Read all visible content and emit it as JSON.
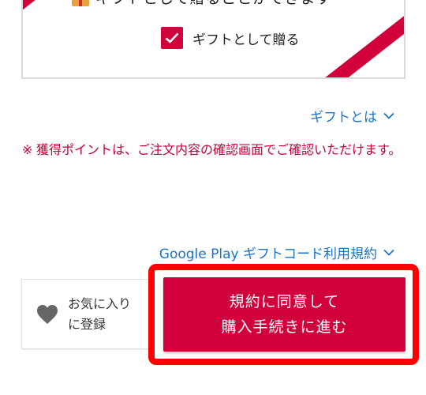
{
  "gift": {
    "caption": "ギフトとして贈ることができます",
    "checkbox_label": "ギフトとして贈る",
    "checked": true
  },
  "links": {
    "gift_about": "ギフトとは",
    "terms": "Google Play ギフトコード利用規約"
  },
  "notice": {
    "mark": "※",
    "text": "獲得ポイントは、ご注文内容の確認画面でご確認いただけます。"
  },
  "favorite": {
    "line1": "お気に入り",
    "line2": "に登録"
  },
  "agree_button": {
    "line1": "規約に同意して",
    "line2": "購入手続きに進む"
  },
  "colors": {
    "accent": "#d1003c",
    "link": "#1a73c8",
    "notice": "#c2003a",
    "highlight": "#ff0000"
  }
}
